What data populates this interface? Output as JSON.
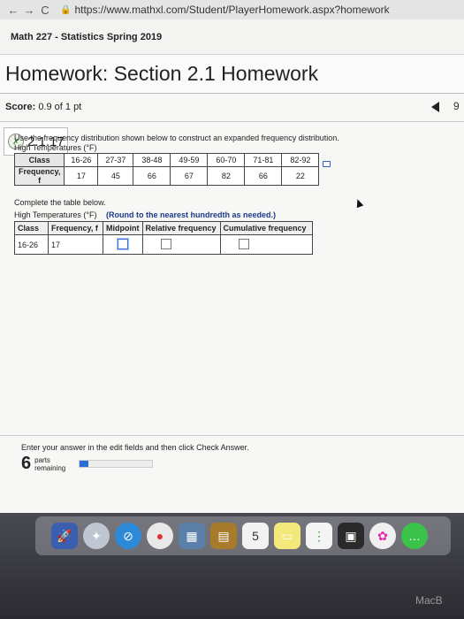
{
  "browser": {
    "back": "←",
    "forward": "→",
    "reload": "C",
    "lock": "🔒",
    "url": "https://www.mathxl.com/Student/PlayerHomework.aspx?homework"
  },
  "course": {
    "title": "Math 227 - Statistics Spring 2019"
  },
  "homework": {
    "title": "Homework: Section 2.1 Homework"
  },
  "score": {
    "label": "Score:",
    "value": "0.9 of 1 pt",
    "next_label": "9"
  },
  "question": {
    "number": "2.1.17",
    "icon": "partial-credit-icon"
  },
  "instructions": {
    "text": "Use the frequency distribution shown below to construct an expanded frequency distribution.",
    "table_title": "High Temperatures (°F)"
  },
  "freq_table": {
    "row_labels": [
      "Class",
      "Frequency, f"
    ],
    "classes": [
      "16-26",
      "27-37",
      "38-48",
      "49-59",
      "60-70",
      "71-81",
      "82-92"
    ],
    "frequencies": [
      "17",
      "45",
      "66",
      "67",
      "82",
      "66",
      "22"
    ]
  },
  "complete": {
    "text": "Complete the table below.",
    "table_title": "High Temperatures (°F)",
    "round_note": "(Round to the nearest hundredth as needed.)"
  },
  "expanded_table": {
    "headers": [
      "Class",
      "Frequency, f",
      "Midpoint",
      "Relative frequency",
      "Cumulative frequency"
    ],
    "row": {
      "class": "16-26",
      "frequency": "17"
    }
  },
  "footer": {
    "hint": "Enter your answer in the edit fields and then click Check Answer.",
    "parts_count": "6",
    "parts_label": "parts remaining",
    "progress": 0.12
  },
  "dock": {
    "brand": "MacB"
  },
  "colors": {
    "accent": "#2b6fd6",
    "round_note": "#1b3a8a"
  }
}
